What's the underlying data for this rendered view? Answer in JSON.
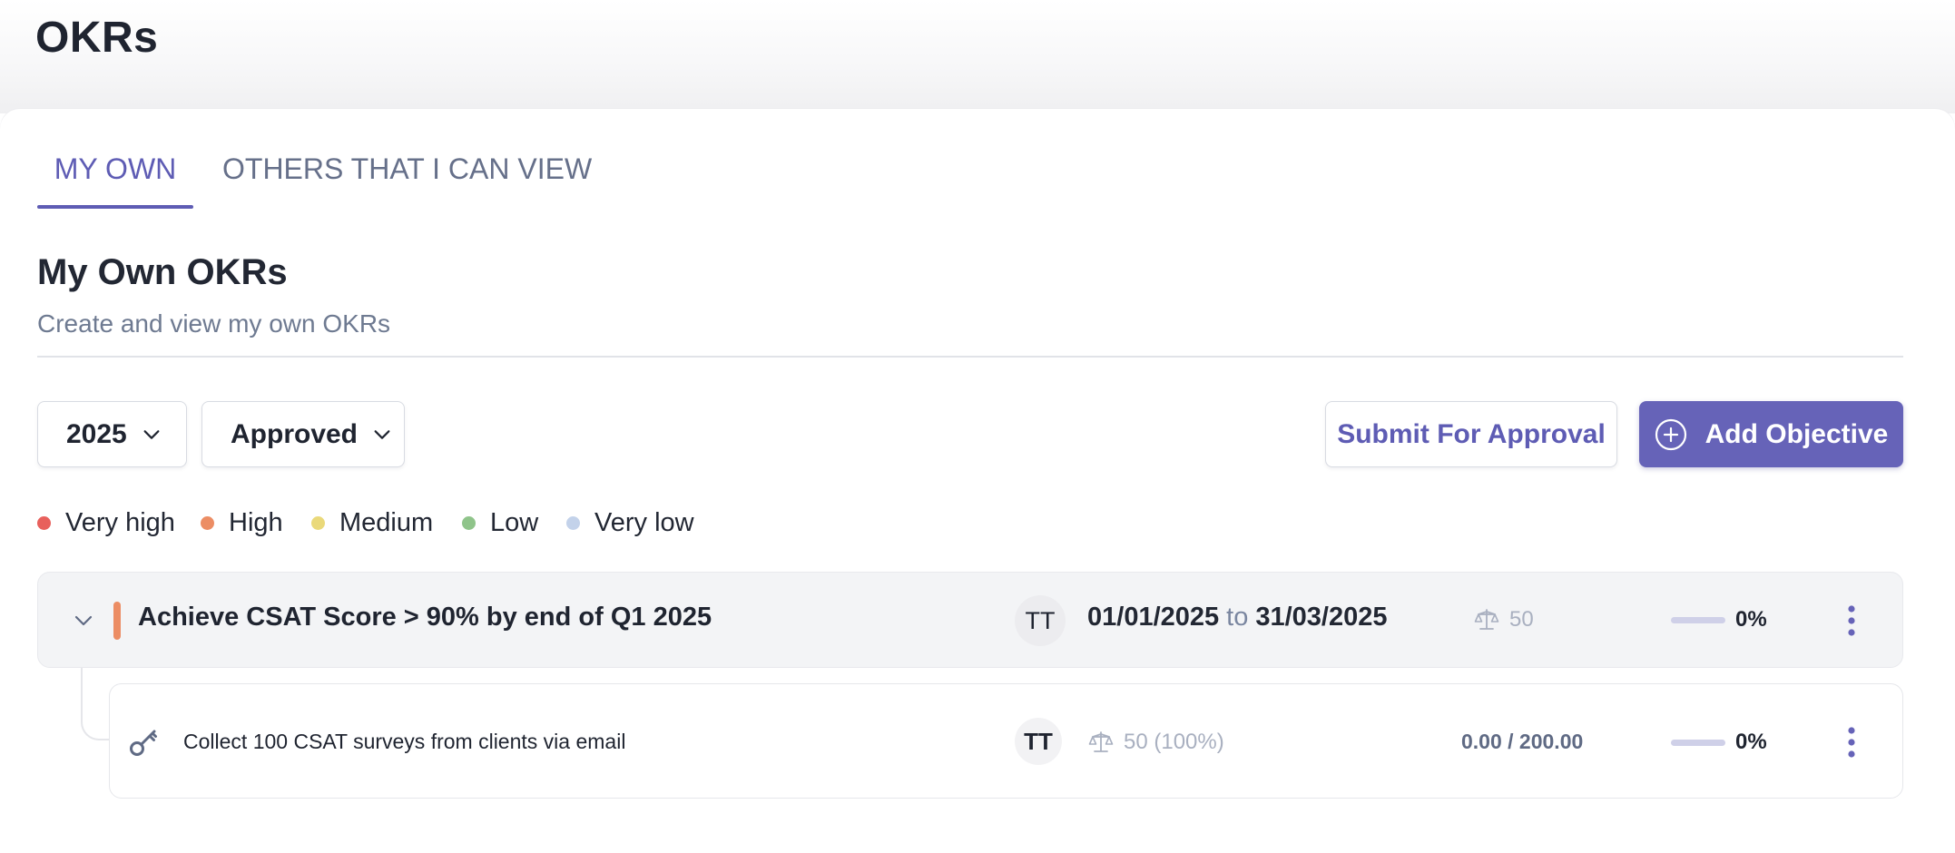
{
  "header": {
    "title": "OKRs"
  },
  "tabs": [
    {
      "label": "MY OWN",
      "active": true
    },
    {
      "label": "OTHERS THAT I CAN VIEW",
      "active": false
    }
  ],
  "section": {
    "title": "My Own OKRs",
    "subtitle": "Create and view my own OKRs"
  },
  "filters": {
    "year": "2025",
    "status": "Approved"
  },
  "actions": {
    "submit_label": "Submit For Approval",
    "add_label": "Add Objective"
  },
  "legend": [
    {
      "label": "Very high",
      "color": "#e8605c"
    },
    {
      "label": "High",
      "color": "#ec8d64"
    },
    {
      "label": "Medium",
      "color": "#ead97a"
    },
    {
      "label": "Low",
      "color": "#8fc48a"
    },
    {
      "label": "Very low",
      "color": "#c3d2ea"
    }
  ],
  "objective": {
    "title": "Achieve CSAT Score > 90% by end of Q1 2025",
    "priority_color": "#ec8d64",
    "owner_initials": "TT",
    "start_date": "01/01/2025",
    "to_label": "to",
    "end_date": "31/03/2025",
    "weight": "50",
    "progress_label": "0%",
    "progress_fraction": 0
  },
  "key_results": [
    {
      "title": "Collect 100 CSAT surveys from clients via email",
      "owner_initials": "TT",
      "weight": "50 (100%)",
      "value": "0.00 / 200.00",
      "progress_label": "0%",
      "progress_fraction": 0
    }
  ],
  "colors": {
    "accent": "#6663b8",
    "tab_active": "#5e5cb4"
  }
}
